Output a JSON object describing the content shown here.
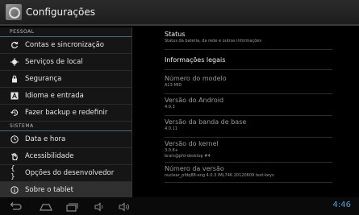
{
  "actionbar": {
    "title": "Configurações"
  },
  "sidebar": {
    "section_personal": "PESSOAL",
    "section_system": "SISTEMA",
    "personal_items": [
      {
        "label": "Contas e sincronização",
        "icon": "sync-icon"
      },
      {
        "label": "Serviços de local",
        "icon": "location-icon"
      },
      {
        "label": "Segurança",
        "icon": "lock-icon"
      },
      {
        "label": "Idioma e entrada",
        "icon": "language-icon"
      },
      {
        "label": "Fazer backup e redefinir",
        "icon": "backup-icon"
      }
    ],
    "system_items": [
      {
        "label": "Data e hora",
        "icon": "clock-icon"
      },
      {
        "label": "Acessibilidade",
        "icon": "accessibility-icon"
      },
      {
        "label": "Opções do desenvolvedor",
        "icon": "braces-icon"
      },
      {
        "label": "Sobre o tablet",
        "icon": "info-icon"
      }
    ]
  },
  "detail": {
    "status_title": "Status",
    "status_sub": "Status da bateria, da rede e outras informações",
    "legal_title": "Informações legais",
    "model_title": "Número do modelo",
    "model_value": "A13-MID",
    "android_title": "Versão do Android",
    "android_value": "4.0.3",
    "baseband_title": "Versão da banda de base",
    "baseband_value": "4.0.11",
    "kernel_title": "Versão do kernel",
    "kernel_value_1": "3.0.8+",
    "kernel_value_2": "brain@pfd-desktop #4",
    "build_title": "Número da versão",
    "build_value": "nuclear_pfdq88-eng 4.0.3 IML74K 20120609 test-keys"
  },
  "navbar": {
    "clock": "4:46"
  },
  "colors": {
    "accent": "#3d6e84",
    "clock": "#4aa3d8"
  }
}
